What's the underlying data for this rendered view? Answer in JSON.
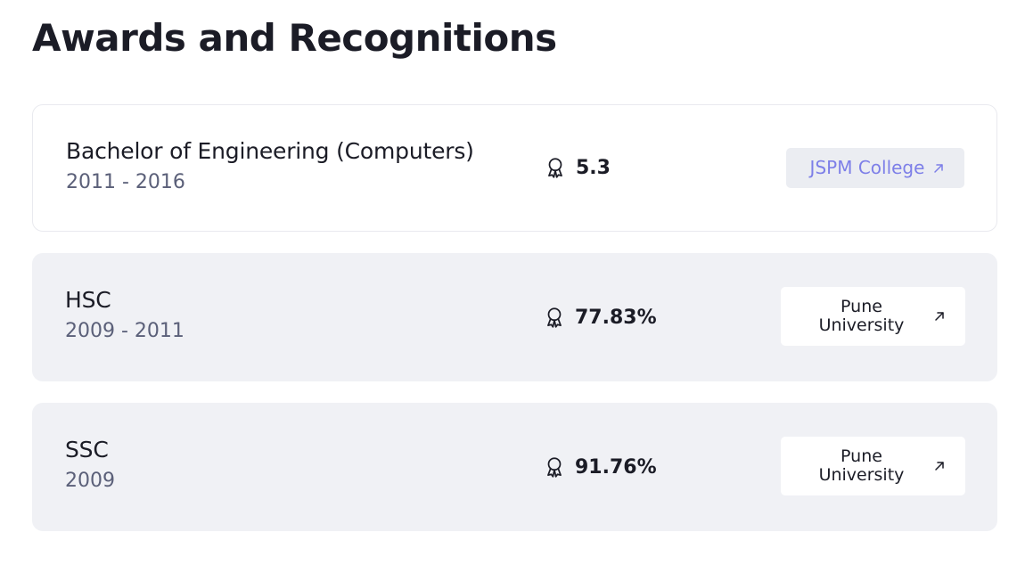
{
  "page": {
    "title": "Awards and Recognitions"
  },
  "theme": {
    "accent": "#7d7fe8",
    "text": "#1b1c26",
    "muted": "#5b6079",
    "card_fill": "#f0f1f5",
    "card_border": "#e9eaef"
  },
  "entries": [
    {
      "degree": "Bachelor of Engineering (Computers)",
      "years": "2011 - 2016",
      "score": "5.3",
      "score_icon": "award-ribbon-icon",
      "institution": "JSPM College",
      "link_icon": "arrow-up-right-icon"
    },
    {
      "degree": "HSC",
      "years": "2009 - 2011",
      "score": "77.83%",
      "score_icon": "award-ribbon-icon",
      "institution": "Pune University",
      "link_icon": "arrow-up-right-icon"
    },
    {
      "degree": "SSC",
      "years": "2009",
      "score": "91.76%",
      "score_icon": "award-ribbon-icon",
      "institution": "Pune University",
      "link_icon": "arrow-up-right-icon"
    }
  ]
}
